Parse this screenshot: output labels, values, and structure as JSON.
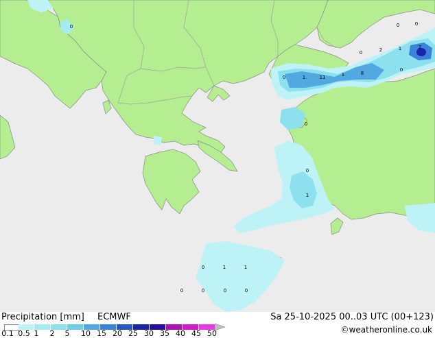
{
  "map": {
    "colors": {
      "sea": "#ececec",
      "land": "#b4ee90",
      "coast": "#8a8a8a",
      "border": "#a0a0a0"
    },
    "precip_labels": [
      "0",
      "0",
      "2",
      "1",
      "2",
      "0",
      "0",
      "1",
      "11",
      "1",
      "8",
      "0",
      "0",
      "0",
      "1",
      "0",
      "0",
      "1",
      "1",
      "0",
      "0",
      "0",
      "0"
    ]
  },
  "footer": {
    "title": "Precipitation [mm]",
    "model": "ECMWF",
    "datetime": "Sa 25-10-2025 00..03 UTC (00+123)",
    "credit": "©weatheronline.co.uk",
    "scale_labels": [
      "0.1",
      "0.5",
      "1",
      "2",
      "5",
      "10",
      "15",
      "20",
      "25",
      "30",
      "35",
      "40",
      "45",
      "50"
    ],
    "scale_colors": [
      "#ffffff",
      "#bdf3f6",
      "#a6ebf2",
      "#8de1ee",
      "#6fcdea",
      "#52a9e2",
      "#3a83da",
      "#2656c4",
      "#1a26aa",
      "#2a0ea0",
      "#b010b8",
      "#d418cc",
      "#ea3ae6",
      "#c0c0c0"
    ]
  }
}
